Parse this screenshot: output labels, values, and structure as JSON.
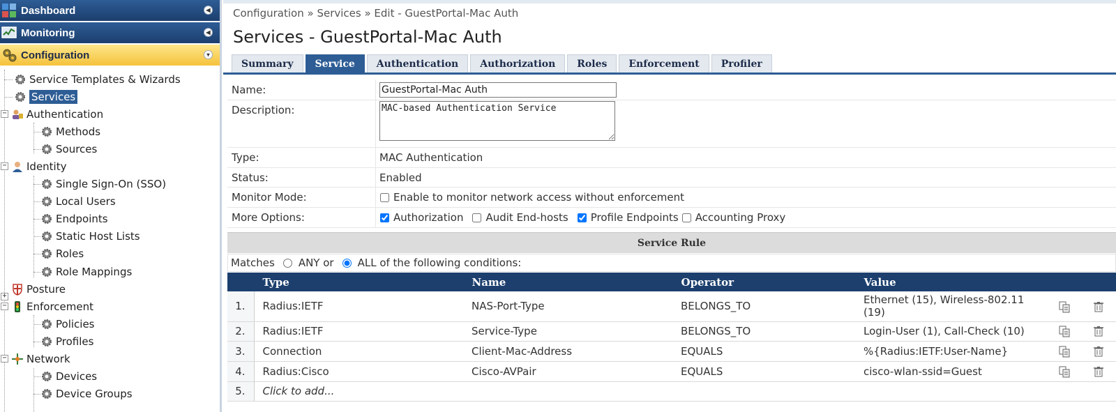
{
  "sidebar": {
    "dashboard": "Dashboard",
    "monitoring": "Monitoring",
    "configuration": "Configuration",
    "tree": {
      "service_templates": "Service Templates & Wizards",
      "services": "Services",
      "authentication": "Authentication",
      "methods": "Methods",
      "sources": "Sources",
      "identity": "Identity",
      "sso": "Single Sign-On (SSO)",
      "local_users": "Local Users",
      "endpoints": "Endpoints",
      "static_host_lists": "Static Host Lists",
      "roles": "Roles",
      "role_mappings": "Role Mappings",
      "posture": "Posture",
      "enforcement": "Enforcement",
      "policies": "Policies",
      "profiles": "Profiles",
      "network": "Network",
      "devices": "Devices",
      "device_groups": "Device Groups"
    },
    "expander_minus": "−",
    "expander_plus": "+"
  },
  "breadcrumb": "Configuration » Services » Edit - GuestPortal-Mac Auth",
  "page_title": "Services - GuestPortal-Mac Auth",
  "tabs": [
    "Summary",
    "Service",
    "Authentication",
    "Authorization",
    "Roles",
    "Enforcement",
    "Profiler"
  ],
  "form": {
    "name_label": "Name:",
    "name_value": "GuestPortal-Mac Auth",
    "description_label": "Description:",
    "description_value": "MAC-based Authentication Service",
    "type_label": "Type:",
    "type_value": "MAC Authentication",
    "status_label": "Status:",
    "status_value": "Enabled",
    "monitor_label": "Monitor Mode:",
    "monitor_text": "Enable to monitor network access without enforcement",
    "more_label": "More Options:",
    "opt_authorization": "Authorization",
    "opt_audit": "Audit End-hosts",
    "opt_profile": "Profile Endpoints",
    "opt_accounting": "Accounting Proxy"
  },
  "rule": {
    "header": "Service Rule",
    "matches": "Matches",
    "any": "ANY or",
    "all": "ALL of the following conditions:",
    "columns": [
      "Type",
      "Name",
      "Operator",
      "Value"
    ],
    "rows": [
      {
        "num": "1.",
        "type": "Radius:IETF",
        "name": "NAS-Port-Type",
        "operator": "BELONGS_TO",
        "value": "Ethernet (15), Wireless-802.11 (19)"
      },
      {
        "num": "2.",
        "type": "Radius:IETF",
        "name": "Service-Type",
        "operator": "BELONGS_TO",
        "value": "Login-User (1), Call-Check (10)"
      },
      {
        "num": "3.",
        "type": "Connection",
        "name": "Client-Mac-Address",
        "operator": "EQUALS",
        "value": "%{Radius:IETF:User-Name}"
      },
      {
        "num": "4.",
        "type": "Radius:Cisco",
        "name": "Cisco-AVPair",
        "operator": "EQUALS",
        "value": "cisco-wlan-ssid=Guest"
      }
    ],
    "add_num": "5.",
    "add_placeholder": "Click to add..."
  }
}
